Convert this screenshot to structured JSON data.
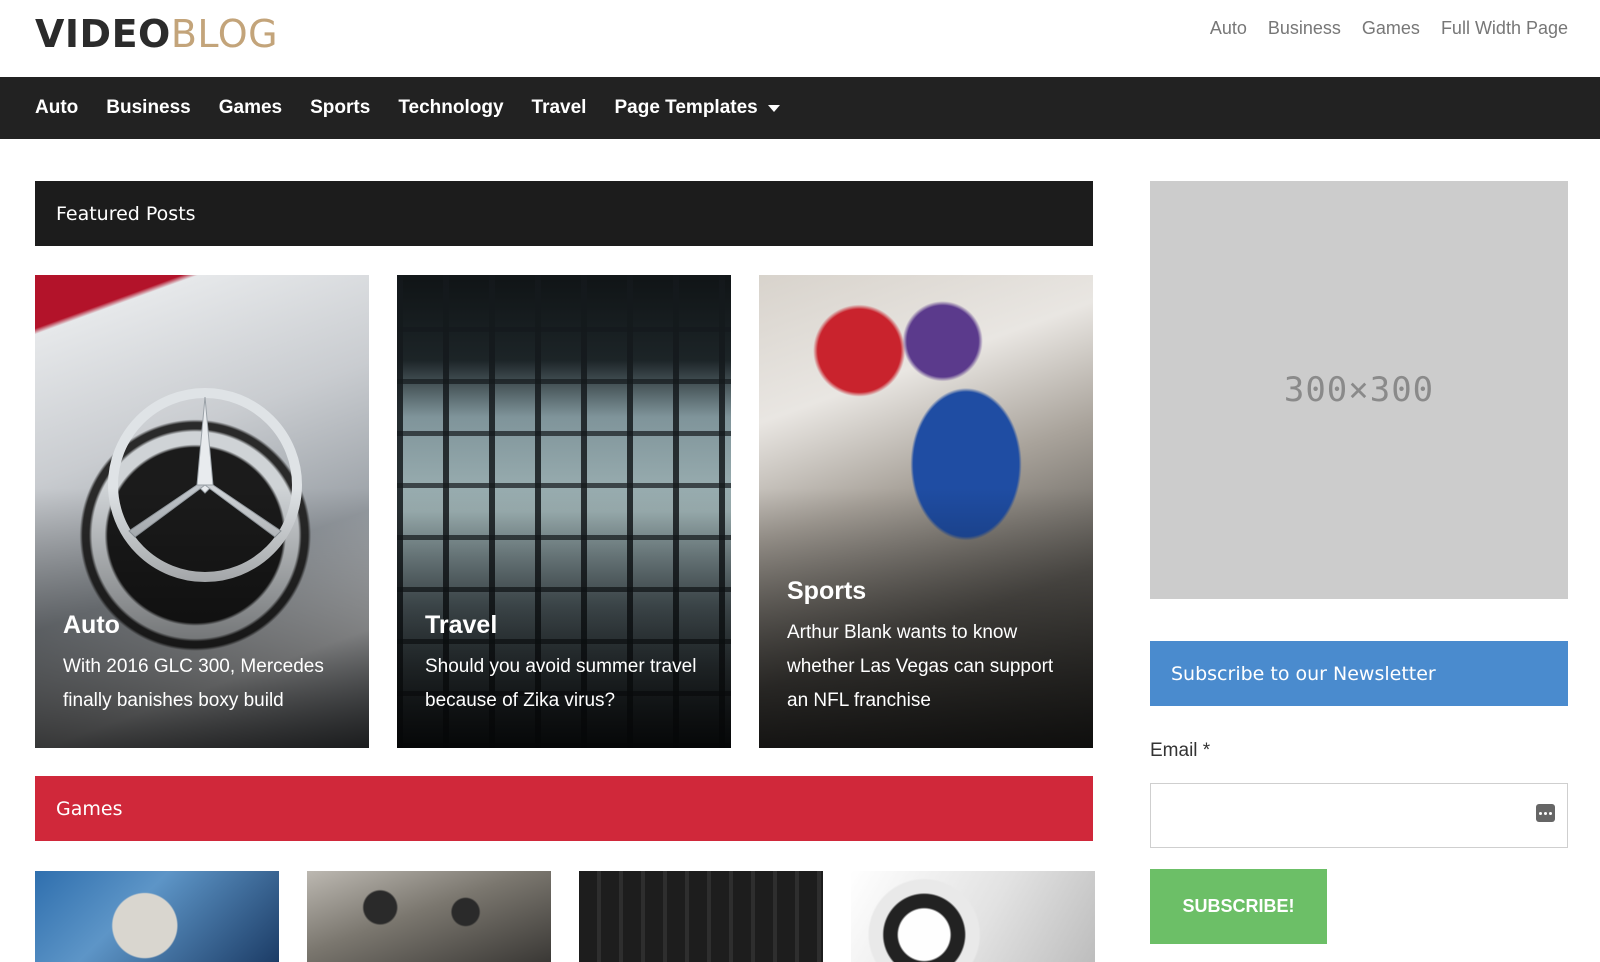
{
  "header": {
    "logo_bold": "VIDEO",
    "logo_light": "BLOG",
    "top_menu": [
      {
        "label": "Auto"
      },
      {
        "label": "Business"
      },
      {
        "label": "Games"
      },
      {
        "label": "Full Width Page"
      }
    ]
  },
  "main_nav": {
    "items": [
      {
        "label": "Auto"
      },
      {
        "label": "Business"
      },
      {
        "label": "Games"
      },
      {
        "label": "Sports"
      },
      {
        "label": "Technology"
      },
      {
        "label": "Travel"
      },
      {
        "label": "Page Templates"
      }
    ]
  },
  "featured": {
    "heading": "Featured Posts",
    "cards": [
      {
        "category": "Auto",
        "title": "With 2016 GLC 300, Mercedes finally banishes boxy build"
      },
      {
        "category": "Travel",
        "title": "Should you avoid summer travel because of Zika virus?"
      },
      {
        "category": "Sports",
        "title": "Arthur Blank wants to know whether Las Vegas can support an NFL franchise"
      }
    ]
  },
  "games": {
    "heading": "Games"
  },
  "sidebar": {
    "ad_label": "300×300",
    "newsletter_heading": "Subscribe to our Newsletter",
    "email_label": "Email *",
    "email_value": "",
    "subscribe_label": "SUBSCRIBE!"
  },
  "colors": {
    "nav_bg": "#222222",
    "featured_bar": "#1c1c1c",
    "games_bar": "#d0283a",
    "newsletter_bar": "#4a8bce",
    "subscribe_btn": "#6cbf67",
    "logo_accent": "#c3a47a"
  }
}
